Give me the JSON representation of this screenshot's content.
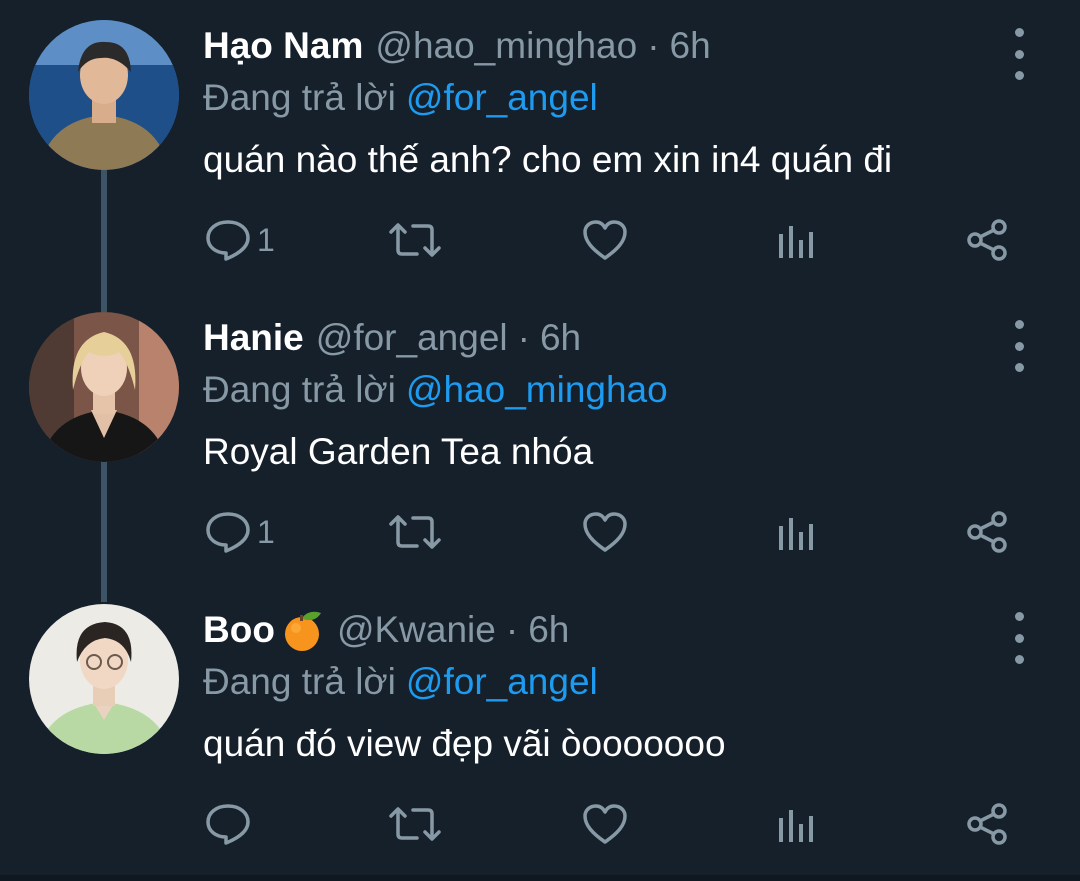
{
  "thread": {
    "tweets": [
      {
        "name": "Hạo Nam",
        "handle": "@hao_minghao",
        "separator": "·",
        "time": "6h",
        "replying_prefix": "Đang trả lời",
        "replying_to": "@for_angel",
        "text": "quán nào thế anh? cho em xin in4 quán đi",
        "reply_count": "1"
      },
      {
        "name": "Hanie",
        "handle": "@for_angel",
        "separator": "·",
        "time": "6h",
        "replying_prefix": "Đang trả lời",
        "replying_to": "@hao_minghao",
        "text": "Royal Garden Tea nhóa",
        "reply_count": "1"
      },
      {
        "name": "Boo",
        "name_emoji": "tangerine-emoji",
        "handle": "@Kwanie",
        "separator": "·",
        "time": "6h",
        "replying_prefix": "Đang trả lời",
        "replying_to": "@for_angel",
        "text": "quán đó view đẹp vãi òooooooo",
        "reply_count": ""
      }
    ]
  },
  "icons": {
    "reply": "speech-bubble-icon",
    "retweet": "retweet-icon",
    "like": "heart-icon",
    "analytics": "bar-chart-icon",
    "share": "share-icon",
    "more": "vertical-ellipsis-icon"
  },
  "colors": {
    "background": "#15202b",
    "primary_text": "#ffffff",
    "secondary_text": "#8899a6",
    "mention": "#1d9bf0",
    "thread_line": "#3d5466"
  }
}
